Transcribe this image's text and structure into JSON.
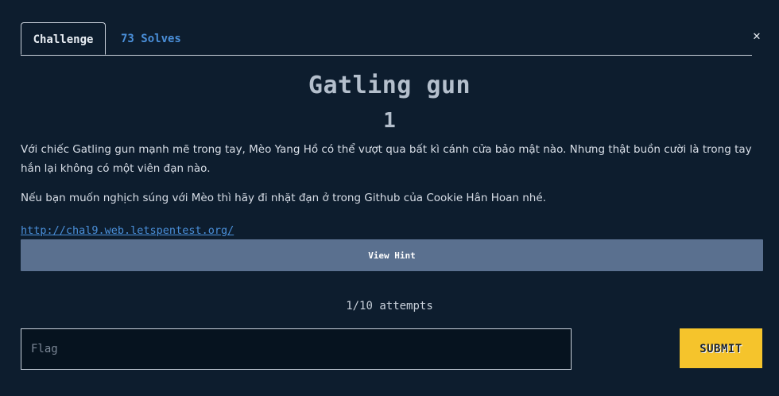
{
  "tabs": {
    "challenge": "Challenge",
    "solves": "73 Solves"
  },
  "close_icon": "✕",
  "challenge": {
    "name": "Gatling gun",
    "value": "1",
    "description": [
      "Với chiếc Gatling gun mạnh mẽ trong tay, Mèo Yang Hồ có thể vượt qua bất kì cánh cửa bảo mật nào. Nhưng thật buồn cười là trong tay hắn lại không có một viên đạn nào.",
      "Nếu bạn muốn nghịch súng với Mèo thì hãy đi nhặt đạn ở trong Github của Cookie Hân Hoan nhé."
    ],
    "link": "http://chal9.web.letspentest.org/"
  },
  "hint_button": "View Hint",
  "attempts": "1/10 attempts",
  "flag_input": {
    "placeholder": "Flag",
    "value": ""
  },
  "submit_button": "SUBMIT",
  "colors": {
    "background": "#0d1d2e",
    "link": "#4a8fd9",
    "hint_button": "#5a708f",
    "submit_button": "#f5c42c"
  }
}
